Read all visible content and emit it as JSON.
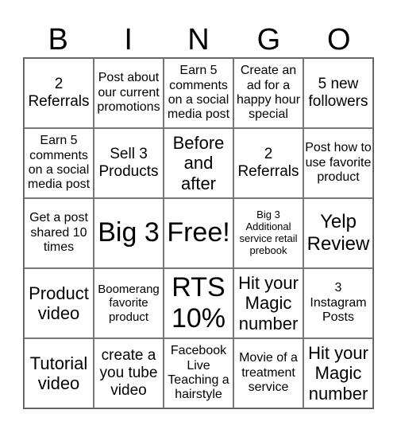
{
  "header": {
    "letters": [
      "B",
      "I",
      "N",
      "G",
      "O"
    ]
  },
  "cells": [
    [
      "2 Referrals",
      "Post about our current promotions",
      "Earn 5 comments on a social media post",
      "Create an ad for a happy hour special",
      "5 new followers"
    ],
    [
      "Earn 5 comments on a social media post",
      "Sell 3 Products",
      "Before and after",
      "2 Referrals",
      "Post how to use favorite product"
    ],
    [
      "Get a post shared 10 times",
      "Big 3",
      "Free!",
      "Big 3 Additional service retail prebook",
      "Yelp Review"
    ],
    [
      "Product video",
      "Boomerang favorite product",
      "RTS 10%",
      "Hit your Magic number",
      "3 Instagram Posts"
    ],
    [
      "Tutorial video",
      "create a you tube video",
      "Facebook Live Teaching a hairstyle",
      "Movie of a treatment service",
      "Hit your Magic number"
    ]
  ]
}
